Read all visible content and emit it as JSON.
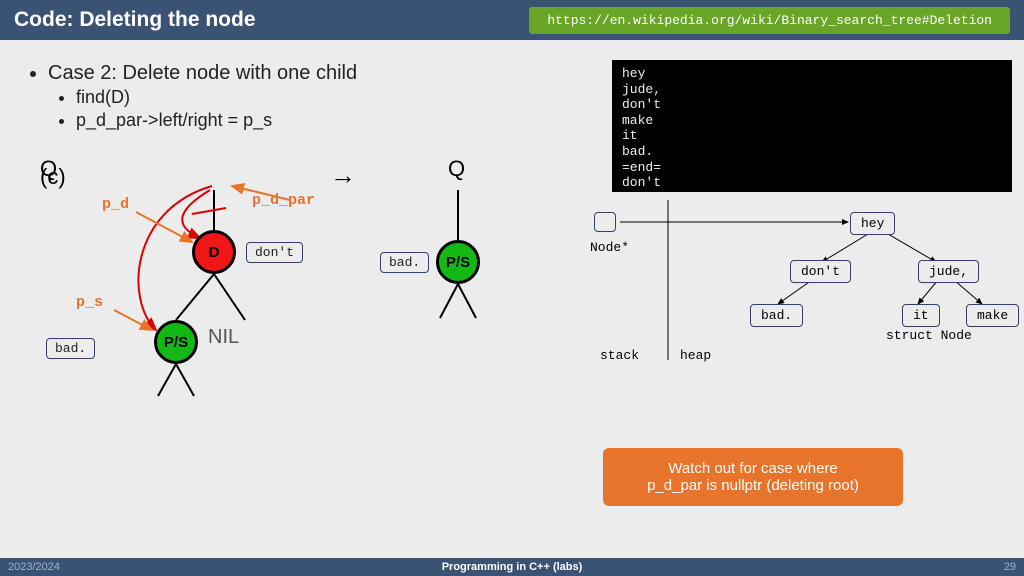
{
  "header": {
    "title": "Code: Deleting the node",
    "url": "https://en.wikipedia.org/wiki/Binary_search_tree#Deletion"
  },
  "bullets": {
    "main": "Case 2: Delete node with one child",
    "sub1": "find(D)",
    "sub2": "p_d_par->left/right = p_s"
  },
  "terminal": "hey\njude,\ndon't\nmake\nit\nbad.\n=end=\ndon't",
  "diagram": {
    "figure_label": "(c)",
    "Q1": "Q",
    "D": "D",
    "PS": "P/S",
    "NIL": "NIL",
    "arrow": "→",
    "Q2": "Q",
    "p_d": "p_d",
    "p_d_par": "p_d_par",
    "p_s": "p_s",
    "dont": "don't",
    "bad": "bad.",
    "bad2": "bad."
  },
  "heap": {
    "nodestar": "Node*",
    "stack": "stack",
    "heap": "heap",
    "struct": "struct Node",
    "n0": "hey",
    "n1": "don't",
    "n2": "jude,",
    "n3": "bad.",
    "n4": "it",
    "n5": "make"
  },
  "warn": {
    "l1": "Watch out for case where",
    "l2": "p_d_par is nullptr (deleting root)"
  },
  "footer": {
    "left": "2023/2024",
    "center": "Programming in C++ (labs)",
    "right": "29"
  }
}
